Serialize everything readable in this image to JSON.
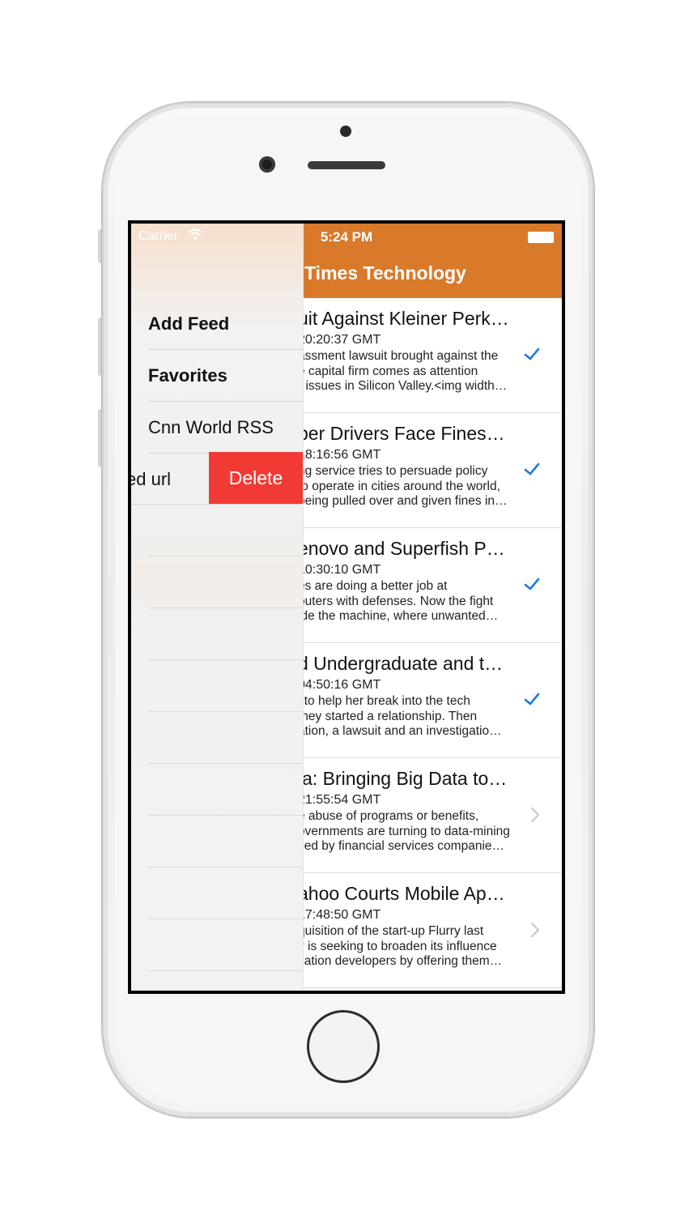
{
  "status_bar": {
    "carrier": "Carrier",
    "time": "5:24 PM"
  },
  "navbar": {
    "title": "t Times Technology"
  },
  "articles": [
    {
      "title": "uit Against Kleiner Perk…",
      "date": " 20:20:37 GMT",
      "desc": [
        "assment lawsuit brought against the",
        "e capital firm comes as attention",
        "r issues in Silicon Valley.<img width…"
      ],
      "accessory": "checkmark-icon"
    },
    {
      "title": "ber Drivers Face Fines…",
      "date": " 18:16:56 GMT",
      "desc": [
        "ng service tries to persuade policy",
        " to operate in cities around the world,",
        "being pulled over and given fines in…"
      ],
      "accessory": "checkmark-icon"
    },
    {
      "title": "enovo and Superfish P…",
      "date": " 10:30:10 GMT",
      "desc": [
        "es are doing a better job at",
        "outers with defenses. Now the fight",
        "ide the machine, where unwanted…"
      ],
      "accessory": "checkmark-icon"
    },
    {
      "title": "d Undergraduate and t…",
      "date": " 04:50:16 GMT",
      "desc": [
        "l to help her break into the tech",
        " they started a relationship. Then",
        "ation, a lawsuit and an investigatio…"
      ],
      "accessory": "checkmark-icon"
    },
    {
      "title": "ia: Bringing Big Data to…",
      "date": "21:55:54 GMT",
      "desc": [
        "e abuse of programs or benefits,",
        "overnments are turning to data-mining",
        "sed by financial services companie…"
      ],
      "accessory": "chevron-right-icon"
    },
    {
      "title": "ahoo Courts Mobile Ap…",
      "date": "17:48:50 GMT",
      "desc": [
        "quisition of the start-up Flurry last",
        "y is seeking to broaden its influence",
        "cation developers by offering them…"
      ],
      "accessory": "chevron-right-icon"
    }
  ],
  "drawer": {
    "items": [
      {
        "label": "Add Feed"
      },
      {
        "label": "Favorites"
      },
      {
        "label": "Cnn World RSS"
      }
    ],
    "swiped_item": {
      "label": "ed url",
      "delete_label": "Delete"
    }
  },
  "colors": {
    "nav": "#d97a2b",
    "delete": "#f23a35",
    "check": "#1e7ae0"
  }
}
